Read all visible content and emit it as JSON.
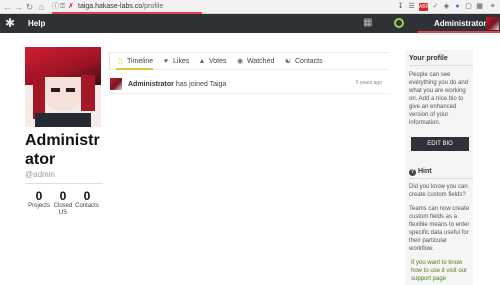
{
  "browser": {
    "url_host": "taiga.hakase-labs.co",
    "url_path": "/profile",
    "red_badge": "ABP"
  },
  "topbar": {
    "help_label": "Help",
    "user_name": "Administrator"
  },
  "profile": {
    "name": "Administrator",
    "handle": "@admin",
    "stats": [
      {
        "value": "0",
        "label": "Projects"
      },
      {
        "value": "0",
        "label": "Closed US"
      },
      {
        "value": "0",
        "label": "Contacts"
      }
    ]
  },
  "tabs": [
    {
      "label": "Timeline",
      "icon": "timeline-icon",
      "active": true
    },
    {
      "label": "Likes",
      "icon": "heart-icon",
      "active": false
    },
    {
      "label": "Votes",
      "icon": "vote-icon",
      "active": false
    },
    {
      "label": "Watched",
      "icon": "eye-icon",
      "active": false
    },
    {
      "label": "Contacts",
      "icon": "contacts-icon",
      "active": false
    }
  ],
  "timeline": [
    {
      "who": "Administrator",
      "text": "has joined Taiga",
      "time": "5 years ago"
    }
  ],
  "sidebar": {
    "profile_title": "Your profile",
    "profile_text": "People can see everything you do and what you are working on. Add a nice bio to give an enhanced version of your information.",
    "edit_bio_label": "EDIT BIO",
    "hint_title": "Hint",
    "hint_question": "Did you know you can create custom fields?",
    "hint_text": "Teams can now create custom fields as a flexible means to enter specific data useful for their particular workflow.",
    "hint_link": "If you want to know how to use it visit our support page"
  },
  "colors": {
    "topbar": "#2e3237",
    "accent_red": "#e4404f",
    "tab_active": "#e0c341",
    "link_green": "#4a7d1b"
  }
}
